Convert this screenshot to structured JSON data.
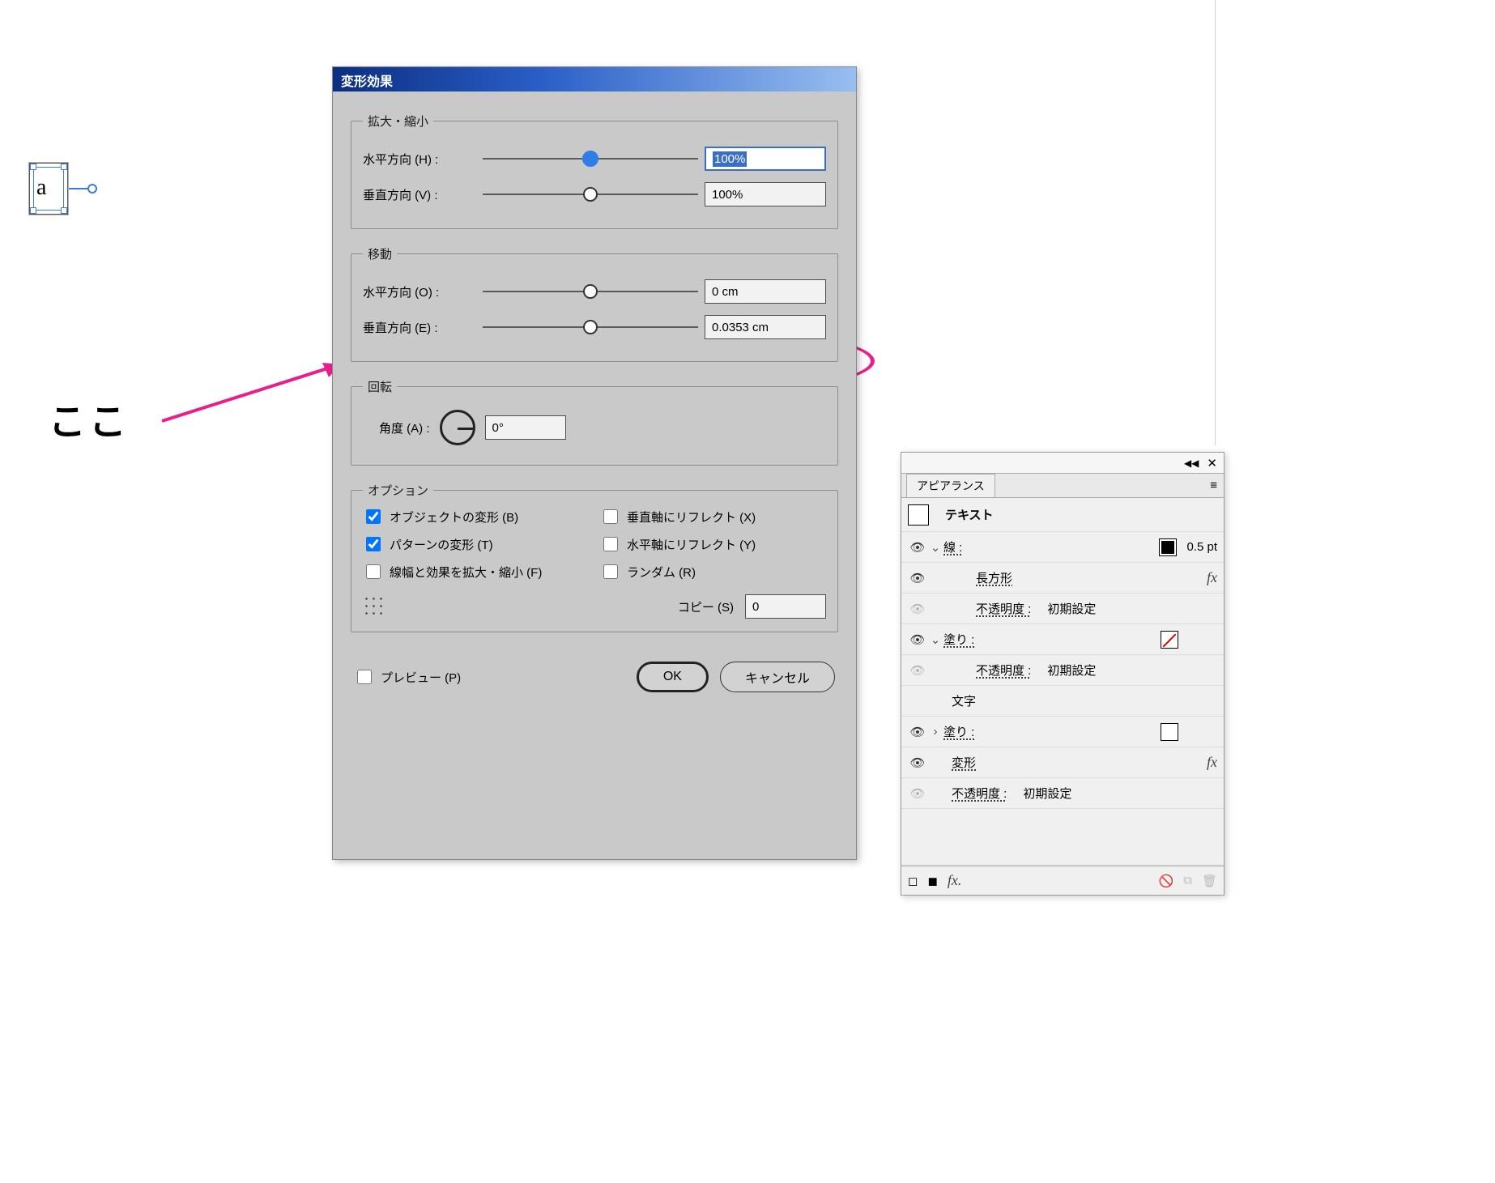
{
  "page_edge": true,
  "object_sample_char": "a",
  "annotation": {
    "text": "ここ"
  },
  "dialog": {
    "title": "変形効果",
    "scale": {
      "legend": "拡大・縮小",
      "h_label": "水平方向 (H) :",
      "h_value": "100%",
      "v_label": "垂直方向 (V) :",
      "v_value": "100%"
    },
    "move": {
      "legend": "移動",
      "h_label": "水平方向 (O) :",
      "h_value": "0 cm",
      "v_label": "垂直方向 (E) :",
      "v_value": "0.0353 cm"
    },
    "rotate": {
      "legend": "回転",
      "angle_label": "角度 (A) :",
      "angle_value": "0°"
    },
    "options": {
      "legend": "オプション",
      "transform_objects": "オブジェクトの変形 (B)",
      "transform_patterns": "パターンの変形 (T)",
      "scale_strokes": "線幅と効果を拡大・縮小 (F)",
      "reflect_x": "垂直軸にリフレクト (X)",
      "reflect_y": "水平軸にリフレクト (Y)",
      "random": "ランダム (R)",
      "copies_label": "コピー (S)",
      "copies_value": "0"
    },
    "preview_label": "プレビュー (P)",
    "ok_label": "OK",
    "cancel_label": "キャンセル"
  },
  "panel": {
    "tab_label": "アピアランス",
    "text_item": "テキスト",
    "rows": {
      "stroke_label": "線 :",
      "stroke_weight": "0.5 pt",
      "rectangle": "長方形",
      "opacity_label": "不透明度 :",
      "opacity_value": "初期設定",
      "fill_label": "塗り :",
      "characters": "文字",
      "transform": "変形"
    }
  }
}
